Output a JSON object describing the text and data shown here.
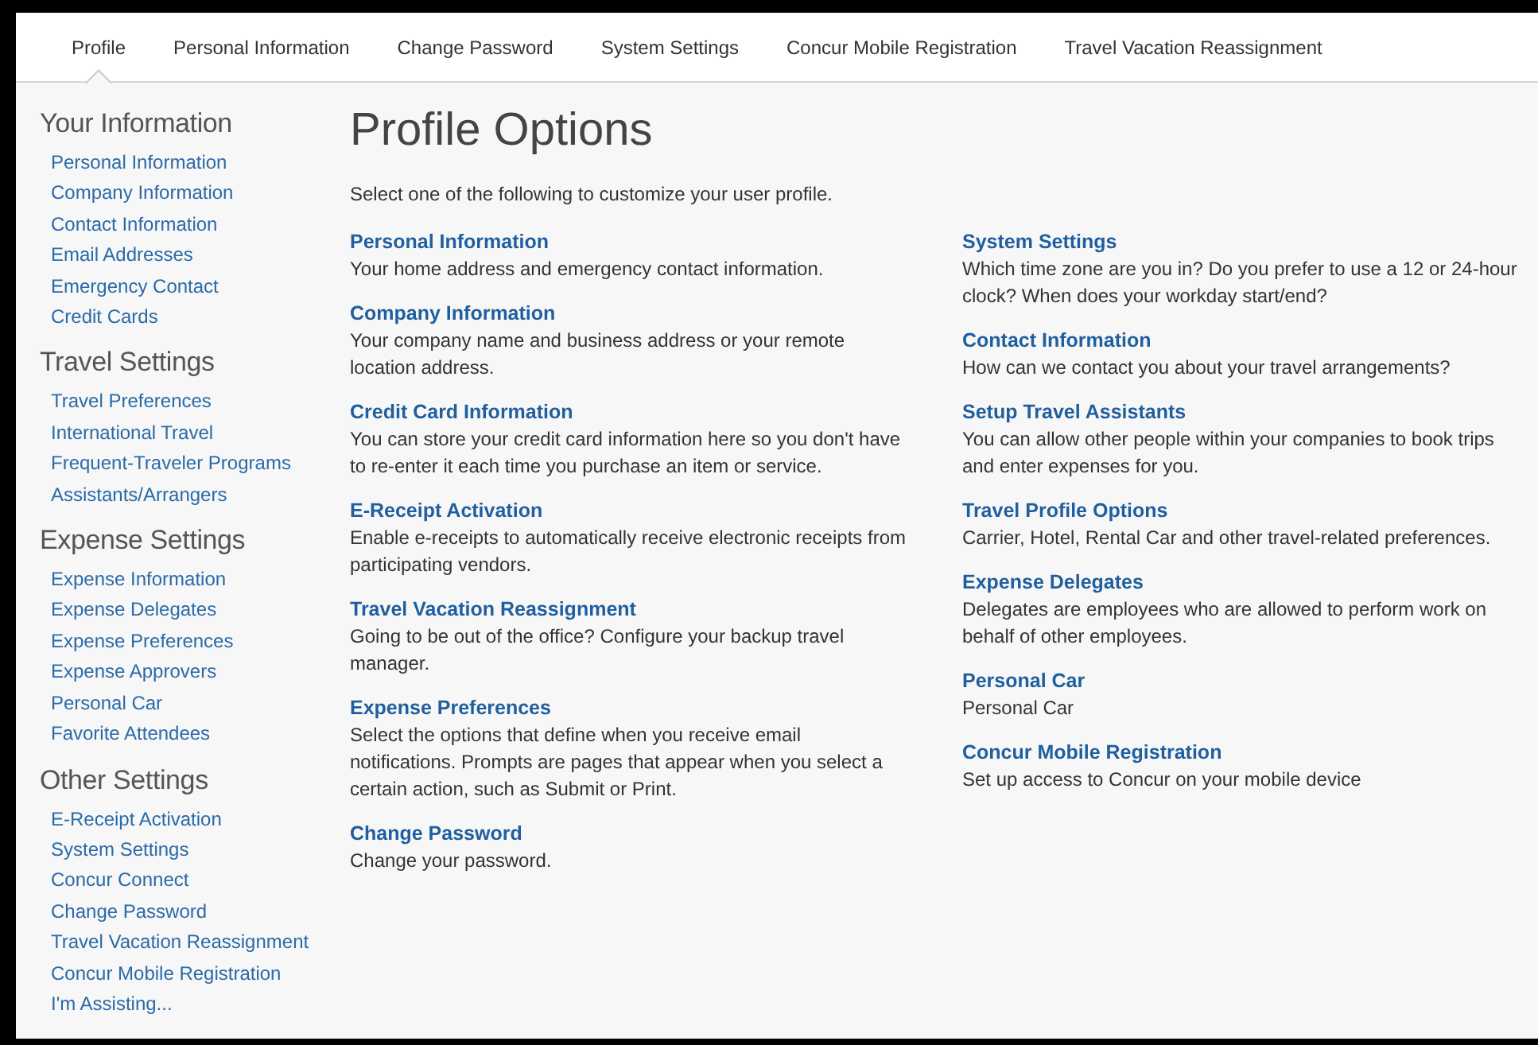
{
  "tabs": [
    {
      "label": "Profile",
      "selected": true
    },
    {
      "label": "Personal Information",
      "selected": false
    },
    {
      "label": "Change Password",
      "selected": false
    },
    {
      "label": "System Settings",
      "selected": false
    },
    {
      "label": "Concur Mobile Registration",
      "selected": false
    },
    {
      "label": "Travel Vacation Reassignment",
      "selected": false
    }
  ],
  "sidebar": {
    "sections": [
      {
        "title": "Your Information",
        "items": [
          "Personal Information",
          "Company Information",
          "Contact Information",
          "Email Addresses",
          "Emergency Contact",
          "Credit Cards"
        ]
      },
      {
        "title": "Travel Settings",
        "items": [
          "Travel Preferences",
          "International Travel",
          "Frequent-Traveler Programs",
          "Assistants/Arrangers"
        ]
      },
      {
        "title": "Expense Settings",
        "items": [
          "Expense Information",
          "Expense Delegates",
          "Expense Preferences",
          "Expense Approvers",
          "Personal Car",
          "Favorite Attendees"
        ]
      },
      {
        "title": "Other Settings",
        "items": [
          "E-Receipt Activation",
          "System Settings",
          "Concur Connect",
          "Change Password",
          "Travel Vacation Reassignment",
          "Concur Mobile Registration",
          "I'm Assisting..."
        ]
      }
    ]
  },
  "main": {
    "title": "Profile Options",
    "intro": "Select one of the following to customize your user profile.",
    "columns": [
      [
        {
          "title": "Personal Information",
          "description": "Your home address and emergency contact information."
        },
        {
          "title": "Company Information",
          "description": "Your company name and business address or your remote location address."
        },
        {
          "title": "Credit Card Information",
          "description": "You can store your credit card information here so you don't have to re-enter it each time you purchase an item or service."
        },
        {
          "title": "E-Receipt Activation",
          "description": "Enable e-receipts to automatically receive electronic receipts from participating vendors."
        },
        {
          "title": "Travel Vacation Reassignment",
          "description": "Going to be out of the office? Configure your backup travel manager."
        },
        {
          "title": "Expense Preferences",
          "description": "Select the options that define when you receive email notifications. Prompts are pages that appear when you select a certain action, such as Submit or Print."
        },
        {
          "title": "Change Password",
          "description": "Change your password."
        }
      ],
      [
        {
          "title": "System Settings",
          "description": "Which time zone are you in? Do you prefer to use a 12 or 24-hour clock? When does your workday start/end?"
        },
        {
          "title": "Contact Information",
          "description": "How can we contact you about your travel arrangements?"
        },
        {
          "title": "Setup Travel Assistants",
          "description": "You can allow other people within your companies to book trips and enter expenses for you."
        },
        {
          "title": "Travel Profile Options",
          "description": "Carrier, Hotel, Rental Car and other travel-related preferences."
        },
        {
          "title": "Expense Delegates",
          "description": "Delegates are employees who are allowed to perform work on behalf of other employees."
        },
        {
          "title": "Personal Car",
          "description": "Personal Car"
        },
        {
          "title": "Concur Mobile Registration",
          "description": "Set up access to Concur on your mobile device"
        }
      ]
    ]
  }
}
